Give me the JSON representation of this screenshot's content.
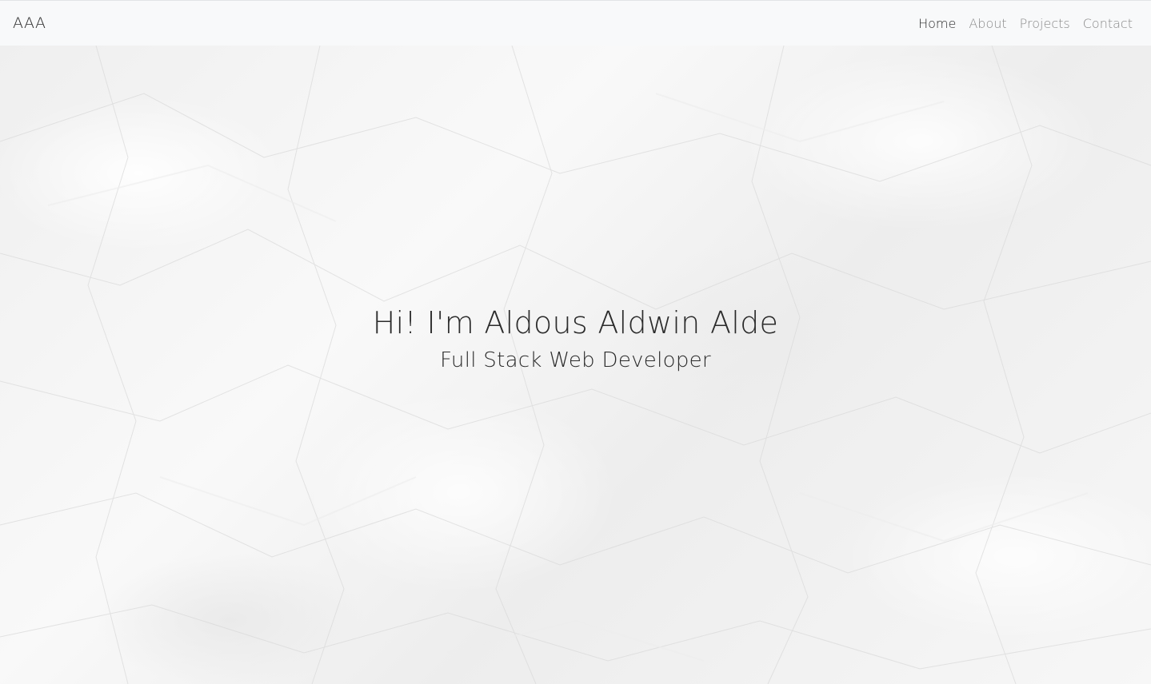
{
  "navbar": {
    "brand": "AAA",
    "links": [
      {
        "label": "Home",
        "active": true
      },
      {
        "label": "About",
        "active": false
      },
      {
        "label": "Projects",
        "active": false
      },
      {
        "label": "Contact",
        "active": false
      }
    ]
  },
  "hero": {
    "title": "Hi! I'm Aldous Aldwin Alde",
    "subtitle": "Full Stack Web Developer",
    "background": "crumpled-paper-texture"
  },
  "colors": {
    "navbar_bg": "#f8f9fa",
    "text_dark": "#2b2b2b",
    "nav_muted": "#8a8a8a"
  }
}
